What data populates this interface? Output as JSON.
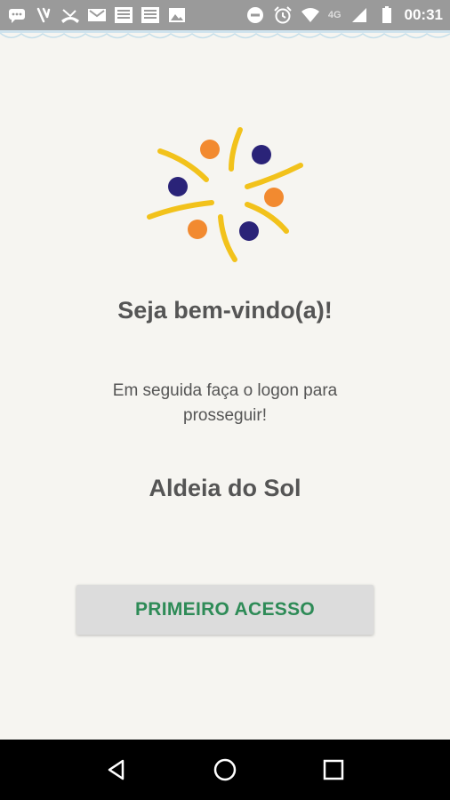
{
  "status_bar": {
    "time": "00:31",
    "network": "4G",
    "icons": [
      "chat-icon",
      "vibrate-icon",
      "missed-call-icon",
      "mail-icon",
      "news-icon",
      "news-icon",
      "image-icon",
      "do-not-disturb-icon",
      "alarm-icon",
      "wifi-icon",
      "signal-icon",
      "battery-icon"
    ]
  },
  "main": {
    "welcome": "Seja bem-vindo(a)!",
    "subtitle": "Em seguida faça o logon para prosseguir!",
    "org_name": "Aldeia do Sol",
    "primary_button": "PRIMEIRO ACESSO"
  },
  "colors": {
    "background": "#f6f5f1",
    "status_bar": "#9a9a9a",
    "button_text": "#2e8b57",
    "button_bg": "#dcdcdc",
    "logo_yellow": "#f2c21b",
    "logo_orange": "#f28a30",
    "logo_navy": "#2a2378"
  },
  "nav": {
    "icons": [
      "back-icon",
      "home-icon",
      "recents-icon"
    ]
  }
}
